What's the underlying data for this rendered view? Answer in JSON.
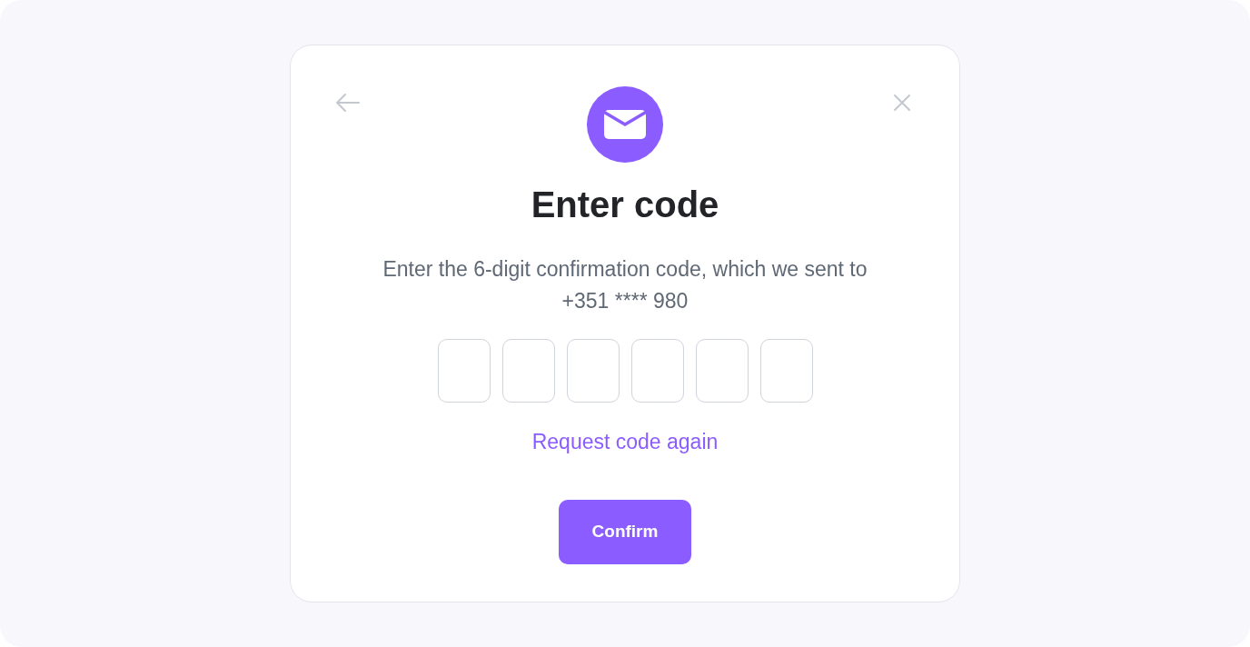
{
  "dialog": {
    "title": "Enter code",
    "description": "Enter the 6-digit confirmation code, which we sent to",
    "phone": "+351 **** 980",
    "code_inputs": [
      {
        "focused": false
      },
      {
        "focused": false
      },
      {
        "focused": false
      },
      {
        "focused": false
      },
      {
        "focused": false
      },
      {
        "focused": false
      }
    ],
    "resend_link": "Request code again",
    "confirm_button": "Confirm"
  }
}
